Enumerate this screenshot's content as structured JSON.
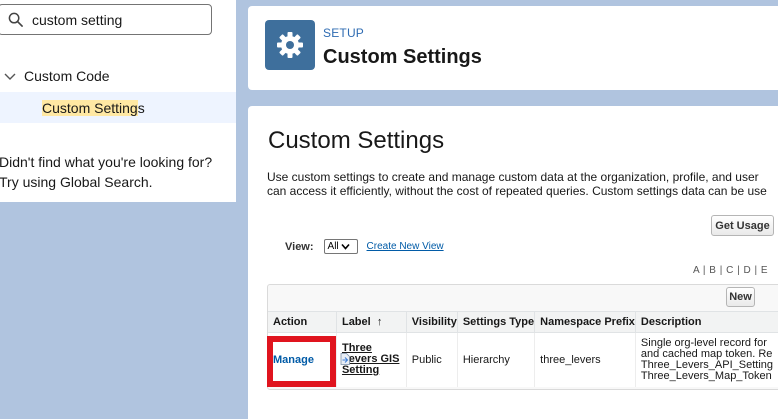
{
  "quick_find": {
    "search_value": "custom setting",
    "tree_parent_label": "Custom Code",
    "tree_child_match": "Custom Setting",
    "tree_child_rest": "s",
    "not_found_text": "Didn't find what you're looking for? Try using Global Search."
  },
  "header": {
    "kicker": "SETUP",
    "title": "Custom Settings",
    "icon": "gear-icon"
  },
  "page": {
    "heading": "Custom Settings",
    "description_line1": "Use custom settings to create and manage custom data at the organization, profile, and user",
    "description_line2": "can access it efficiently, without the cost of repeated queries. Custom settings data can be use",
    "get_usage_label": "Get Usage",
    "view_label": "View:",
    "view_selected": "All",
    "create_view_label": "Create New View",
    "alpha_filter": "A | B | C | D | E",
    "new_label": "New"
  },
  "table": {
    "headers": [
      "Action",
      "Label",
      "Visibility",
      "Settings Type",
      "Namespace Prefix",
      "Description"
    ],
    "sort_indicator": "↑",
    "row": {
      "action": "Manage",
      "label": "Three Levers GIS Setting",
      "visibility": "Public",
      "settings_type": "Hierarchy",
      "namespace_prefix": "three_levers",
      "description_lines": [
        "Single org-level record for",
        "and cached map token. Re",
        "Three_Levers_API_Setting",
        "Three_Levers_Map_Token"
      ]
    }
  },
  "colors": {
    "highlight": "#e0141e",
    "header_icon_bg": "#3e6f9c",
    "link": "#015ba7",
    "background": "#b0c4df"
  }
}
